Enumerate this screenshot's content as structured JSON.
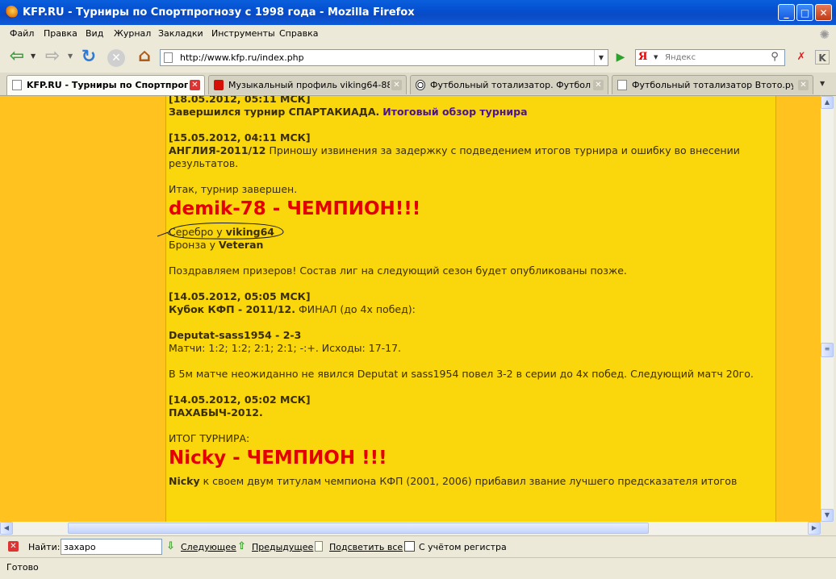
{
  "window": {
    "title": "KFP.RU - Турниры по Спортпрогнозу с 1998 года - Mozilla Firefox"
  },
  "menu": [
    "Файл",
    "Правка",
    "Вид",
    "Журнал",
    "Закладки",
    "Инструменты",
    "Справка"
  ],
  "nav": {
    "url": "http://www.kfp.ru/index.php",
    "search_engine_glyph": "Я",
    "search_placeholder": "Яндекс"
  },
  "tabs": [
    {
      "label": "KFP.RU - Турниры по Спортпрог...",
      "active": true
    },
    {
      "label": "Музыкальный профиль viking64-88 ...",
      "active": false
    },
    {
      "label": "Футбольный тотализатор. Футбол ...",
      "active": false
    },
    {
      "label": "Футбольный тотализатор Втото.ру ...",
      "active": false
    }
  ],
  "content": {
    "n1": {
      "date": "[18.05.2012, 05:11 МСК]",
      "text": "Завершился турнир СПАРТАКИАДА.",
      "link": "Итоговый обзор турнира"
    },
    "n2": {
      "date": "[15.05.2012, 04:11 МСК]",
      "title": "АНГЛИЯ-2011/12",
      "text": "Приношу извинения за задержку с подведением итогов турнира и ошибку во внесении результатов.",
      "intro": "Итак, турнир завершен.",
      "champion": "demik-78 - ЧЕМПИОН!!!",
      "silver_label": "Серебро у",
      "silver_name": "viking64",
      "bronze_label": "Бронза у",
      "bronze_name": "Veteran",
      "congrats": "Поздравляем призеров! Состав лиг на следующий сезон будет опубликованы позже."
    },
    "n3": {
      "date": "[14.05.2012, 05:05 МСК]",
      "title": "Кубок КФП - 2011/12.",
      "subtitle": "ФИНАЛ (до 4х побед):",
      "match": "Deputat-sass1954 - 2-3",
      "matches": "Матчи: 1:2; 1:2; 2:1; 2:1; -:+. Исходы: 17-17.",
      "text": "В 5м матче неожиданно не явился Deputat и sass1954 повел 3-2 в серии до 4х побед. Следующий матч 20го."
    },
    "n4": {
      "date": "[14.05.2012, 05:02 МСК]",
      "title": "ПАХАБЫЧ-2012.",
      "result_label": "ИТОГ ТУРНИРА:",
      "champion": "Nicky - ЧЕМПИОН !!!",
      "last_name": "Nicky",
      "last_text": "к своем двум титулам чемпиона КФП (2001, 2006) прибавил звание лучшего предсказателя итогов"
    }
  },
  "findbar": {
    "label": "Найти:",
    "value": "захаро",
    "next": "Следующее",
    "prev": "Предыдущее",
    "highlight": "Подсветить все",
    "match_case": "С учётом регистра"
  },
  "status": "Готово"
}
